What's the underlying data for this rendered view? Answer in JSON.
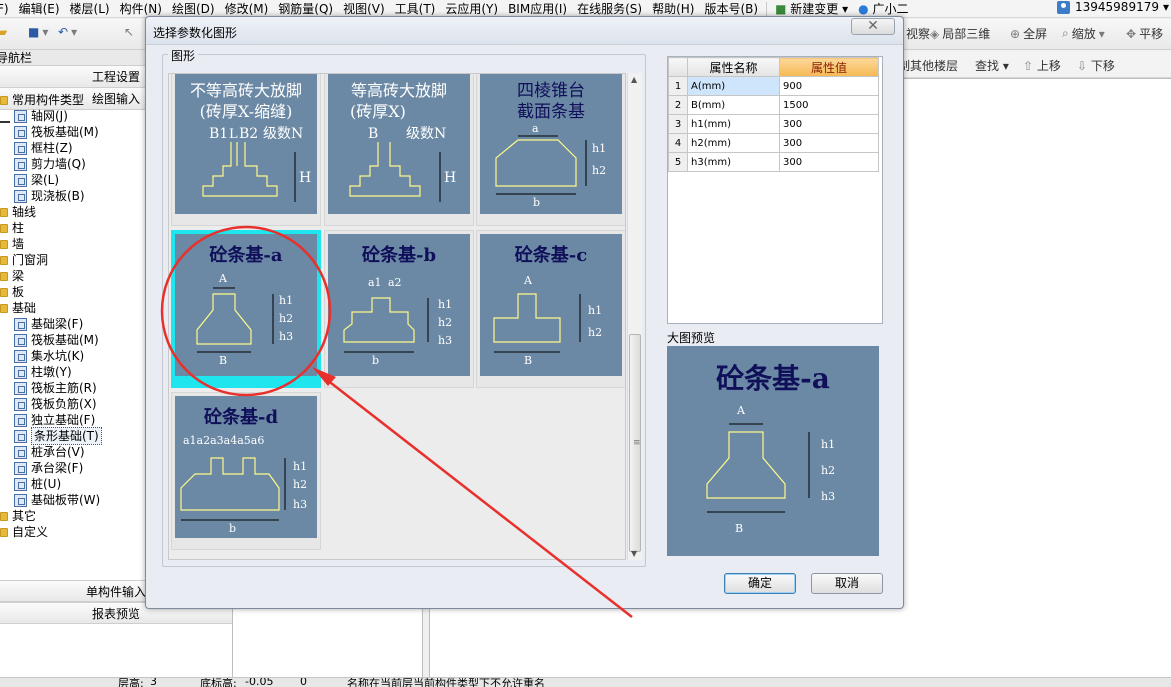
{
  "menubar": {
    "items": [
      "F)",
      "编辑(E)",
      "楼层(L)",
      "构件(N)",
      "绘图(D)",
      "修改(M)",
      "钢筋量(Q)",
      "视图(V)",
      "工具(T)",
      "云应用(Y)",
      "BIM应用(I)",
      "在线服务(S)",
      "帮助(H)",
      "版本号(B)"
    ],
    "new_change": "新建变更",
    "assistant": "广小二",
    "user_phone": "13945989179"
  },
  "toolbar": {
    "view": "视察",
    "local3d": "局部三维",
    "fullscreen": "全屏",
    "zoom": "缩放",
    "pan": "平移",
    "other_floors": "制其他楼层",
    "find": "查找",
    "move_up": "上移",
    "move_down": "下移"
  },
  "nav": {
    "title": "导航栏",
    "project_settings": "工程设置",
    "drawing_input": "绘图输入",
    "single_input": "单构件输入",
    "report_preview": "报表预览",
    "tree": [
      {
        "label": "常用构件类型",
        "level": 0,
        "type": "folder"
      },
      {
        "label": "轴网(J)",
        "level": 1,
        "icon": "grid-icon"
      },
      {
        "label": "筏板基础(M)",
        "level": 1,
        "icon": "raft-icon"
      },
      {
        "label": "框柱(Z)",
        "level": 1,
        "icon": "column-icon"
      },
      {
        "label": "剪力墙(Q)",
        "level": 1,
        "icon": "wall-icon"
      },
      {
        "label": "梁(L)",
        "level": 1,
        "icon": "beam-icon"
      },
      {
        "label": "现浇板(B)",
        "level": 1,
        "icon": "slab-icon"
      },
      {
        "label": "轴线",
        "level": 0,
        "type": "folder"
      },
      {
        "label": "柱",
        "level": 0,
        "type": "folder"
      },
      {
        "label": "墙",
        "level": 0,
        "type": "folder"
      },
      {
        "label": "门窗洞",
        "level": 0,
        "type": "folder"
      },
      {
        "label": "梁",
        "level": 0,
        "type": "folder"
      },
      {
        "label": "板",
        "level": 0,
        "type": "folder"
      },
      {
        "label": "基础",
        "level": 0,
        "type": "folder"
      },
      {
        "label": "基础梁(F)",
        "level": 1,
        "icon": "foundation-beam-icon"
      },
      {
        "label": "筏板基础(M)",
        "level": 1,
        "icon": "raft-icon"
      },
      {
        "label": "集水坑(K)",
        "level": 1,
        "icon": "sump-icon"
      },
      {
        "label": "柱墩(Y)",
        "level": 1,
        "icon": "pier-icon"
      },
      {
        "label": "筏板主筋(R)",
        "level": 1,
        "icon": "rebar-icon"
      },
      {
        "label": "筏板负筋(X)",
        "level": 1,
        "icon": "rebar-icon"
      },
      {
        "label": "独立基础(F)",
        "level": 1,
        "icon": "isolated-footing-icon"
      },
      {
        "label": "条形基础(T)",
        "level": 1,
        "icon": "strip-footing-icon",
        "selected": true
      },
      {
        "label": "桩承台(V)",
        "level": 1,
        "icon": "pile-cap-icon"
      },
      {
        "label": "承台梁(F)",
        "level": 1,
        "icon": "cap-beam-icon"
      },
      {
        "label": "桩(U)",
        "level": 1,
        "icon": "pile-icon"
      },
      {
        "label": "基础板带(W)",
        "level": 1,
        "icon": "strip-icon"
      },
      {
        "label": "其它",
        "level": 0,
        "type": "folder"
      },
      {
        "label": "自定义",
        "level": 0,
        "type": "folder"
      }
    ]
  },
  "status": {
    "floor_height_label": "层高:",
    "floor_height_value": "3",
    "bottom_label": "底标高:",
    "bottom_value": "-0.05",
    "zero": "0",
    "hint": "名称在当前层当前构件类型下不允许重名"
  },
  "dialog": {
    "title": "选择参数化图形",
    "close": "✕",
    "group_label": "图形",
    "preview_label": "大图预览",
    "ok": "确定",
    "cancel": "取消",
    "tiles": [
      {
        "title_line1": "不等高砖大放脚",
        "title_line2": "(砖厚X-缩缝)",
        "labels": [
          "B1",
          "L",
          "B2",
          "级数N",
          "H"
        ]
      },
      {
        "title_line1": "等高砖大放脚",
        "title_line2": "(砖厚X)",
        "labels": [
          "B",
          "级数N",
          "H"
        ]
      },
      {
        "title_line1": "四棱锥台",
        "title_line2": "截面条基",
        "labels": [
          "a",
          "h1",
          "h2",
          "b"
        ]
      },
      {
        "title": "砼条基-a",
        "labels": [
          "A",
          "h1",
          "h2",
          "h3",
          "B"
        ],
        "selected": true
      },
      {
        "title": "砼条基-b",
        "labels": [
          "a1",
          "a2",
          "h1",
          "h2",
          "h3",
          "b"
        ]
      },
      {
        "title": "砼条基-c",
        "labels": [
          "A",
          "h1",
          "h2",
          "B"
        ]
      },
      {
        "title": "砼条基-d",
        "top_label": "a1a2a3a4a5a6",
        "labels": [
          "h1",
          "h2",
          "h3",
          "b"
        ]
      }
    ],
    "props": {
      "col_name": "属性名称",
      "col_value": "属性值",
      "rows": [
        {
          "idx": "1",
          "name": "A(mm)",
          "value": "900"
        },
        {
          "idx": "2",
          "name": "B(mm)",
          "value": "1500"
        },
        {
          "idx": "3",
          "name": "h1(mm)",
          "value": "300"
        },
        {
          "idx": "4",
          "name": "h2(mm)",
          "value": "300"
        },
        {
          "idx": "5",
          "name": "h3(mm)",
          "value": "300"
        }
      ]
    },
    "preview": {
      "title": "砼条基-a",
      "labels": [
        "A",
        "h1",
        "h2",
        "h3",
        "B"
      ]
    }
  },
  "colors": {
    "pic_bg": "#6b89a4",
    "selected_tile": "#1ee5ee",
    "annotation": "#e8302c",
    "shape_line": "#fff98a"
  }
}
